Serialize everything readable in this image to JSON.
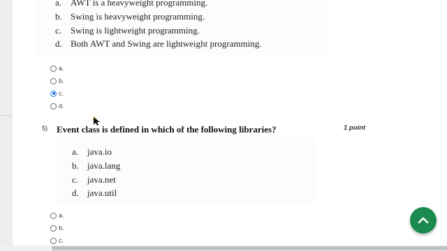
{
  "prev_question": {
    "options": [
      {
        "letter": "a.",
        "text": "AWT is a heavyweight programming."
      },
      {
        "letter": "b.",
        "text": "Swing is heavyweight programming."
      },
      {
        "letter": "c.",
        "text": "Swing is lightweight programming."
      },
      {
        "letter": "d.",
        "text": "Both AWT and Swing are lightweight programming."
      }
    ],
    "answers": [
      {
        "label": "a.",
        "checked": false
      },
      {
        "label": "b.",
        "checked": false
      },
      {
        "label": "c.",
        "checked": true
      },
      {
        "label": "d.",
        "checked": false
      }
    ]
  },
  "question5": {
    "number": "5)",
    "text": "Event class is defined in which of the following libraries?",
    "points": "1 point",
    "options": [
      {
        "letter": "a.",
        "text": "java.io"
      },
      {
        "letter": "b.",
        "text": "java.lang"
      },
      {
        "letter": "c.",
        "text": "java.net"
      },
      {
        "letter": "d.",
        "text": "java.util"
      }
    ],
    "answers": [
      {
        "label": "a.",
        "checked": false
      },
      {
        "label": "b.",
        "checked": false
      },
      {
        "label": "c.",
        "checked": false
      }
    ]
  },
  "colors": {
    "accent": "#1a73e8",
    "fab": "#1b8a4e"
  },
  "fab_icon": "chevron-up-icon"
}
